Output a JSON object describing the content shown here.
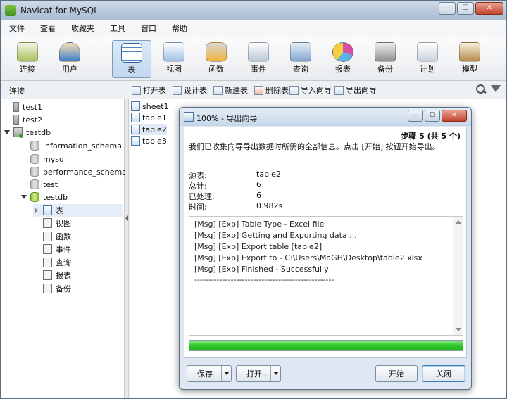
{
  "window": {
    "title": "Navicat for MySQL",
    "controls": {
      "minimize": "—",
      "maximize": "☐",
      "close": "✕"
    }
  },
  "menu": [
    "文件",
    "查看",
    "收藏夹",
    "工具",
    "窗口",
    "帮助"
  ],
  "toolbar": [
    {
      "label": "连接",
      "icon": "plug-icon"
    },
    {
      "label": "用户",
      "icon": "user-icon"
    },
    {
      "label": "表",
      "icon": "table-icon",
      "active": true
    },
    {
      "label": "视图",
      "icon": "view-icon"
    },
    {
      "label": "函数",
      "icon": "function-icon"
    },
    {
      "label": "事件",
      "icon": "event-icon"
    },
    {
      "label": "查询",
      "icon": "query-icon"
    },
    {
      "label": "报表",
      "icon": "report-icon"
    },
    {
      "label": "备份",
      "icon": "backup-icon"
    },
    {
      "label": "计划",
      "icon": "schedule-icon"
    },
    {
      "label": "模型",
      "icon": "model-icon"
    }
  ],
  "subbar": {
    "connection_label": "连接",
    "buttons": [
      "打开表",
      "设计表",
      "新建表",
      "删除表",
      "导入向导",
      "导出向导"
    ]
  },
  "tree": [
    {
      "label": "test1",
      "level": 0,
      "icon": "connection-icon",
      "toggle": ""
    },
    {
      "label": "test2",
      "level": 0,
      "icon": "connection-icon",
      "toggle": ""
    },
    {
      "label": "testdb",
      "level": 0,
      "icon": "connection-open-icon",
      "toggle": "open"
    },
    {
      "label": "information_schema",
      "level": 1,
      "icon": "database-icon",
      "toggle": ""
    },
    {
      "label": "mysql",
      "level": 1,
      "icon": "database-icon",
      "toggle": ""
    },
    {
      "label": "performance_schema",
      "level": 1,
      "icon": "database-icon",
      "toggle": ""
    },
    {
      "label": "test",
      "level": 1,
      "icon": "database-icon",
      "toggle": ""
    },
    {
      "label": "testdb",
      "level": 1,
      "icon": "database-open-icon",
      "toggle": "open"
    },
    {
      "label": "表",
      "level": 2,
      "icon": "table-icon",
      "toggle": "closed",
      "selected": true
    },
    {
      "label": "视图",
      "level": 2,
      "icon": "view-icon",
      "toggle": ""
    },
    {
      "label": "函数",
      "level": 2,
      "icon": "function-icon",
      "toggle": ""
    },
    {
      "label": "事件",
      "level": 2,
      "icon": "event-icon",
      "toggle": ""
    },
    {
      "label": "查询",
      "level": 2,
      "icon": "query-icon",
      "toggle": ""
    },
    {
      "label": "报表",
      "level": 2,
      "icon": "report-icon",
      "toggle": ""
    },
    {
      "label": "备份",
      "level": 2,
      "icon": "backup-icon",
      "toggle": ""
    }
  ],
  "tables": [
    {
      "name": "sheet1"
    },
    {
      "name": "table1"
    },
    {
      "name": "table2",
      "selected": true
    },
    {
      "name": "table3"
    }
  ],
  "dialog": {
    "title": "100% - 导出向导",
    "step": "步骤 5 (共 5 个)",
    "description": "我们已收集向导导出数据时所需的全部信息。点击 [开始] 按钮开始导出。",
    "info": [
      {
        "key": "源表:",
        "value": "table2"
      },
      {
        "key": "总计:",
        "value": "6"
      },
      {
        "key": "已处理:",
        "value": "6"
      },
      {
        "key": "时间:",
        "value": "0.982s"
      }
    ],
    "log": [
      "[Msg] [Exp] Table Type - Excel file",
      "[Msg] [Exp] Getting and Exporting data ...",
      "[Msg] [Exp] Export table [table2]",
      "[Msg] [Exp] Export to - C:\\Users\\MaGH\\Desktop\\table2.xlsx",
      "[Msg] [Exp] Finished - Successfully",
      "--------------------------------------------------"
    ],
    "progress": 1.0,
    "buttons": {
      "save": "保存",
      "open": "打开...",
      "start": "开始",
      "close": "关闭"
    },
    "controls": {
      "minimize": "—",
      "maximize": "☐",
      "close": "✕"
    }
  },
  "colors": {
    "progress": "#2dc52a",
    "title_bar": "#c6d6e8",
    "selection": "#e0e9f5"
  }
}
